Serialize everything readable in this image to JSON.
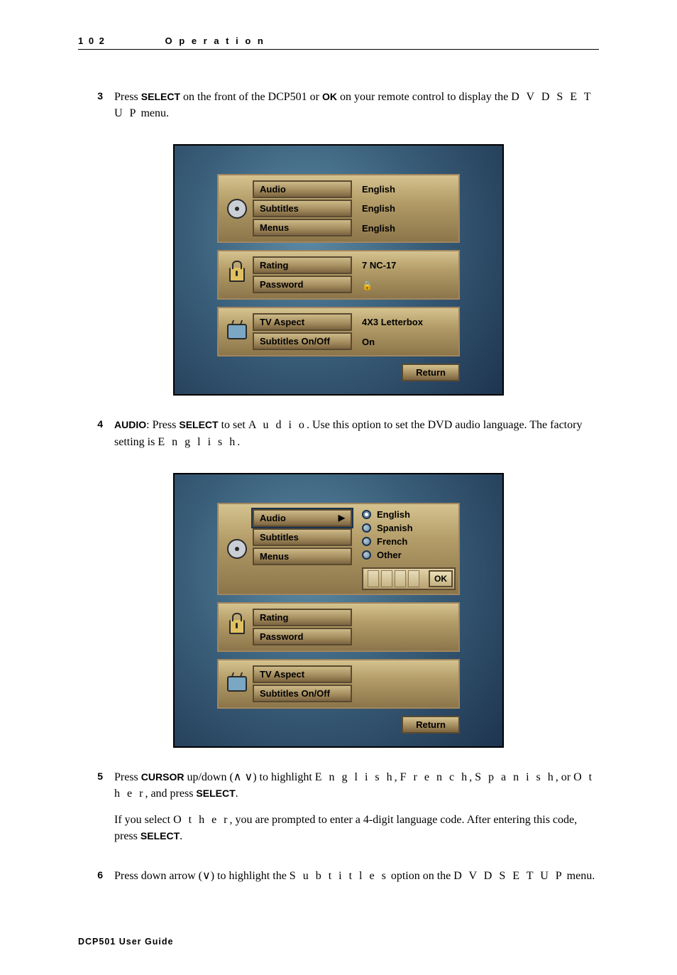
{
  "header": {
    "page_number": "1 0 2",
    "section": "O p e r a t i o n"
  },
  "steps": {
    "s3": {
      "num": "3",
      "text_a": "Press ",
      "b1": "SELECT",
      "text_b": " on the front of the DCP501 or ",
      "b2": "OK",
      "text_c": " on your remote control to display the ",
      "spaced1": "D V D  S E T U P",
      "text_d": " menu."
    },
    "s4": {
      "num": "4",
      "b1": "AUDIO",
      "text_a": ": Press ",
      "b2": "SELECT",
      "text_b": " to set ",
      "spaced1": "A u d i o",
      "text_c": ". Use this option to set the DVD audio language. The factory setting is ",
      "spaced2": "E n g l i s h",
      "text_d": "."
    },
    "s5": {
      "num": "5",
      "text_a": "Press ",
      "b1": "CURSOR",
      "text_b": " up/down (∧ ∨) to highlight ",
      "spaced1": "E n g l i s h",
      "text_c": ", ",
      "spaced2": "F r e n c h",
      "text_d": ", ",
      "spaced3": "S p a n i s h",
      "text_e": ", or ",
      "spaced4": "O t h e r",
      "text_f": ", and press ",
      "b2": "SELECT",
      "text_g": ".",
      "p2_a": "If you select ",
      "p2_spaced": "O t h e r",
      "p2_b": ", you are prompted to enter a 4-digit language code. After entering this code, press ",
      "p2_bold": "SELECT",
      "p2_c": "."
    },
    "s6": {
      "num": "6",
      "text_a": "Press down arrow (∨) to highlight the ",
      "spaced1": "S u b t i t l e s",
      "text_b": " option on the ",
      "spaced2": "D V D  S E T U P",
      "text_c": " menu."
    }
  },
  "osd1": {
    "group1": {
      "items": [
        "Audio",
        "Subtitles",
        "Menus"
      ],
      "values": [
        "English",
        "English",
        "English"
      ]
    },
    "group2": {
      "items": [
        "Rating",
        "Password"
      ],
      "values": [
        "7 NC-17",
        "🔒"
      ]
    },
    "group3": {
      "items": [
        "TV Aspect",
        "Subtitles On/Off"
      ],
      "values": [
        "4X3 Letterbox",
        "On"
      ]
    },
    "return": "Return"
  },
  "osd2": {
    "group1": {
      "items": [
        "Audio",
        "Subtitles",
        "Menus"
      ]
    },
    "group2": {
      "items": [
        "Rating",
        "Password"
      ]
    },
    "group3": {
      "items": [
        "TV Aspect",
        "Subtitles On/Off"
      ]
    },
    "options": [
      "English",
      "Spanish",
      "French",
      "Other"
    ],
    "ok": "OK",
    "return": "Return"
  },
  "footer": "DCP501 User Guide"
}
